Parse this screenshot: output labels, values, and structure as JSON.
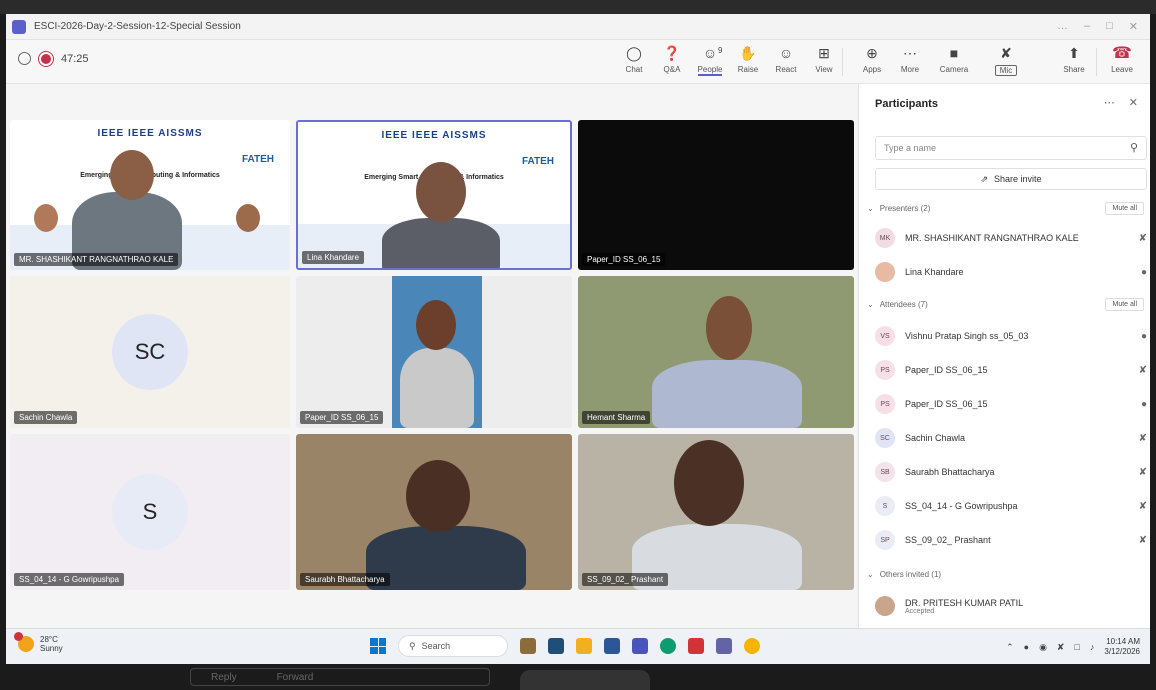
{
  "window": {
    "title": "ESCI-2026-Day-2-Session-12-Special Session",
    "controls": [
      "…",
      "–",
      "□",
      "✕"
    ]
  },
  "meeting": {
    "timer": "47:25"
  },
  "toolbar": {
    "buttons": [
      {
        "label": "Chat",
        "icon": "chat-icon",
        "glyph": "◯"
      },
      {
        "label": "Q&A",
        "icon": "qa-icon",
        "glyph": "❓"
      },
      {
        "label": "People",
        "icon": "people-icon",
        "glyph": "☺",
        "count": "9"
      },
      {
        "label": "Raise",
        "icon": "hand-icon",
        "glyph": "✋"
      },
      {
        "label": "React",
        "icon": "smile-icon",
        "glyph": "☺"
      },
      {
        "label": "View",
        "icon": "grid-icon",
        "glyph": "⊞"
      },
      {
        "label": "Apps",
        "icon": "plus-icon",
        "glyph": "⊕"
      },
      {
        "label": "More",
        "icon": "more-icon",
        "glyph": "⋯"
      },
      {
        "label": "Camera",
        "icon": "camera-icon",
        "glyph": "■"
      },
      {
        "label": "Mic",
        "icon": "mic-off-icon",
        "glyph": "✘"
      },
      {
        "label": "Share",
        "icon": "share-icon",
        "glyph": "⬆"
      },
      {
        "label": "Leave",
        "icon": "phone-hangup-icon",
        "glyph": "☎"
      }
    ]
  },
  "tiles": [
    {
      "name": "MR. SHASHIKANT RANGNATHRAO KALE",
      "kind": "slide"
    },
    {
      "name": "Lina Khandare",
      "kind": "slide"
    },
    {
      "name": "Paper_ID SS_06_15",
      "kind": "black"
    },
    {
      "name": "Sachin Chawla",
      "kind": "avatar",
      "initials": "SC"
    },
    {
      "name": "Paper_ID SS_06_15",
      "kind": "video"
    },
    {
      "name": "Hemant Sharma",
      "kind": "video"
    },
    {
      "name": "SS_04_14 - G Gowripushpa",
      "kind": "avatar",
      "initials": "S"
    },
    {
      "name": "Saurabh Bhattacharya",
      "kind": "video"
    },
    {
      "name": "SS_09_02_ Prashant",
      "kind": "video"
    }
  ],
  "slide": {
    "brand": "IEEE  IEEE  AISSMS",
    "conference": "Emerging Smart Computing & Informatics",
    "partner": "FATEH"
  },
  "panel": {
    "title": "Participants",
    "search_placeholder": "Type a name",
    "share_invite": "Share invite",
    "mute_all": "Mute all",
    "presenters_header": "Presenters (2)",
    "attendees_header": "Attendees (7)",
    "others_header": "Others invited (1)",
    "presenters": [
      {
        "initials": "MK",
        "name": "MR. SHASHIKANT RANGNATHRAO KALE",
        "mic": "muted",
        "color": "#f2dce3"
      },
      {
        "initials": "",
        "name": "Lina Khandare",
        "mic": "on",
        "color": "#e8b9a3"
      }
    ],
    "attendees": [
      {
        "initials": "VS",
        "name": "Vishnu Pratap Singh ss_05_03",
        "mic": "on",
        "color": "#f7dfe6"
      },
      {
        "initials": "PS",
        "name": "Paper_ID SS_06_15",
        "mic": "muted",
        "color": "#f7dfe6"
      },
      {
        "initials": "PS",
        "name": "Paper_ID SS_06_15",
        "mic": "on",
        "color": "#f7dfe6"
      },
      {
        "initials": "SC",
        "name": "Sachin Chawla",
        "mic": "muted",
        "color": "#dfe5f5"
      },
      {
        "initials": "SB",
        "name": "Saurabh Bhattacharya",
        "mic": "muted",
        "color": "#f3e3ea"
      },
      {
        "initials": "S",
        "name": "SS_04_14 - G Gowripushpa",
        "mic": "muted",
        "color": "#e9ecf5"
      },
      {
        "initials": "SP",
        "name": "SS_09_02_ Prashant",
        "mic": "muted",
        "color": "#e9ecf5"
      }
    ],
    "others": [
      {
        "name": "DR. PRITESH KUMAR PATIL",
        "status": "Accepted"
      }
    ]
  },
  "taskbar": {
    "temp": "28°C",
    "weather": "Sunny",
    "search": "Search",
    "time": "10:14 AM",
    "date": "3/12/2026"
  },
  "bottom": {
    "reply": "Reply",
    "forward": "Forward"
  }
}
